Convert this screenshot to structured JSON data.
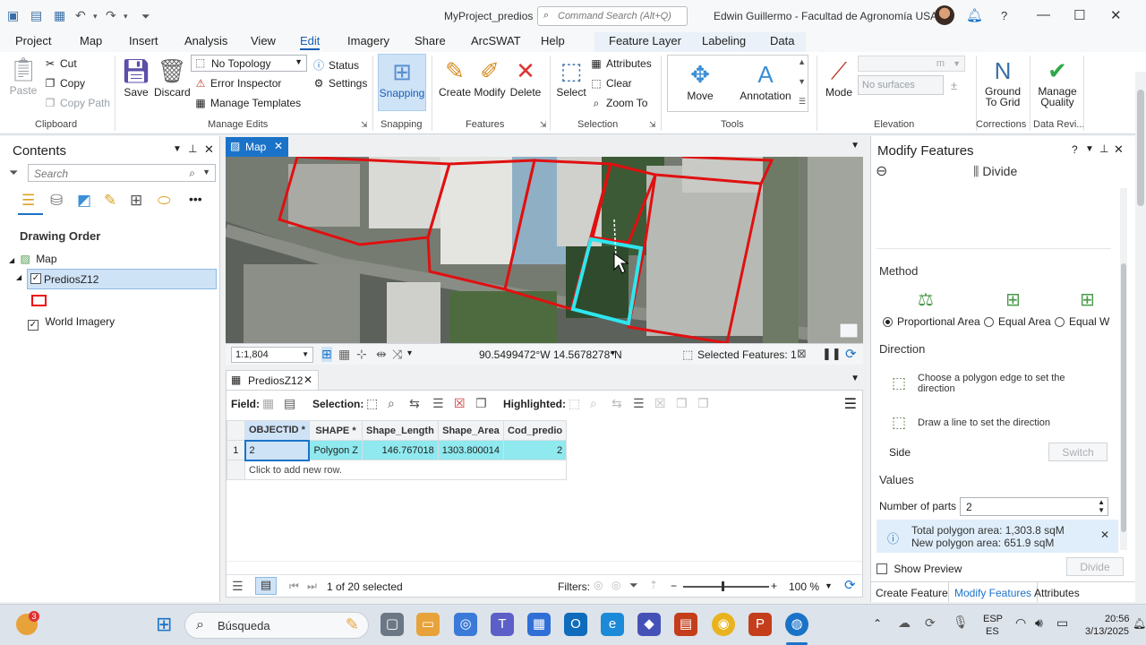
{
  "titlebar": {
    "project_title": "MyProject_predios",
    "command_search_placeholder": "Command Search (Alt+Q)",
    "user": "Edwin Guillermo - Facultad de Agronomía USAC",
    "help": "?"
  },
  "tabs": [
    {
      "label": "Project"
    },
    {
      "label": "Map"
    },
    {
      "label": "Insert"
    },
    {
      "label": "Analysis"
    },
    {
      "label": "View"
    },
    {
      "label": "Edit"
    },
    {
      "label": "Imagery"
    },
    {
      "label": "Share"
    },
    {
      "label": "ArcSWAT"
    },
    {
      "label": "Help"
    }
  ],
  "context_tabs": [
    {
      "label": "Feature Layer"
    },
    {
      "label": "Labeling"
    },
    {
      "label": "Data"
    }
  ],
  "ribbon": {
    "clipboard": {
      "paste": "Paste",
      "cut": "Cut",
      "copy": "Copy",
      "copy_path": "Copy Path",
      "group": "Clipboard"
    },
    "manage_edits": {
      "save": "Save",
      "discard": "Discard",
      "topology": "No Topology",
      "status": "Status",
      "error_inspector": "Error Inspector",
      "settings": "Settings",
      "manage_templates": "Manage Templates",
      "group": "Manage Edits"
    },
    "snapping": {
      "label": "Snapping",
      "group": "Snapping"
    },
    "features": {
      "create": "Create",
      "modify": "Modify",
      "delete": "Delete",
      "group": "Features"
    },
    "selection": {
      "select": "Select",
      "attributes": "Attributes",
      "clear": "Clear",
      "zoom_to": "Zoom To",
      "group": "Selection"
    },
    "tools": {
      "move": "Move",
      "annotation": "Annotation",
      "group": "Tools"
    },
    "elevation": {
      "mode": "Mode",
      "surface_placeholder": "No surfaces",
      "unit": "m",
      "group": "Elevation"
    },
    "corrections": {
      "ground_to_grid": "Ground To Grid",
      "group": "Corrections"
    },
    "data_review": {
      "manage_quality": "Manage Quality",
      "group": "Data Revi..."
    }
  },
  "contents": {
    "title": "Contents",
    "search_placeholder": "Search",
    "drawing_order": "Drawing Order",
    "layers": [
      {
        "name": "Map"
      },
      {
        "name": "PrediosZ12"
      },
      {
        "name": "World Imagery"
      }
    ]
  },
  "map": {
    "tab_label": "Map",
    "scale": "1:1,804",
    "coordinates": "90.5499472°W 14.5678278°N",
    "selected_features": "Selected Features: 1"
  },
  "attribute_table": {
    "tab_label": "PrediosZ12",
    "field_label": "Field:",
    "selection_label": "Selection:",
    "highlighted_label": "Highlighted:",
    "columns": [
      "OBJECTID *",
      "SHAPE *",
      "Shape_Length",
      "Shape_Area",
      "Cod_predio"
    ],
    "rows": [
      {
        "row_num": "1",
        "cells": [
          "2",
          "Polygon Z",
          "146.767018",
          "1303.800014",
          "2"
        ]
      }
    ],
    "add_row_hint": "Click to add new row.",
    "selection_status": "1 of 20 selected",
    "filters_label": "Filters:",
    "zoom": "100 %"
  },
  "modify_pane": {
    "title": "Modify Features",
    "tool": "Divide",
    "method_label": "Method",
    "methods": [
      {
        "label": "Proportional Area",
        "selected": true
      },
      {
        "label": "Equal Area",
        "selected": false
      },
      {
        "label": "Equal W",
        "selected": false
      }
    ],
    "direction_label": "Direction",
    "direction_options": [
      {
        "label": "Choose a polygon edge to set the direction"
      },
      {
        "label": "Draw a line to set the direction"
      }
    ],
    "side_label": "Side",
    "switch_button": "Switch",
    "values_label": "Values",
    "parts_label": "Number of parts",
    "parts_value": "2",
    "info_total": "Total polygon area: 1,303.8 sqM",
    "info_new": "New polygon area: 651.9 sqM",
    "show_preview": "Show Preview",
    "divide_button": "Divide",
    "bottom_tabs": [
      {
        "label": "Create Features",
        "active": false
      },
      {
        "label": "Modify Features",
        "active": true
      },
      {
        "label": "Attributes",
        "active": false
      }
    ]
  },
  "taskbar": {
    "search_placeholder": "Búsqueda",
    "notification_count": "3",
    "lang_1": "ESP",
    "lang_2": "ES",
    "time": "20:56",
    "date": "3/13/2025"
  },
  "colors": {
    "accent": "#1a73c8",
    "parcel_outline": "#e01010",
    "selected_parcel": "#2ee6ee",
    "selected_row": "#8fe9ef"
  }
}
